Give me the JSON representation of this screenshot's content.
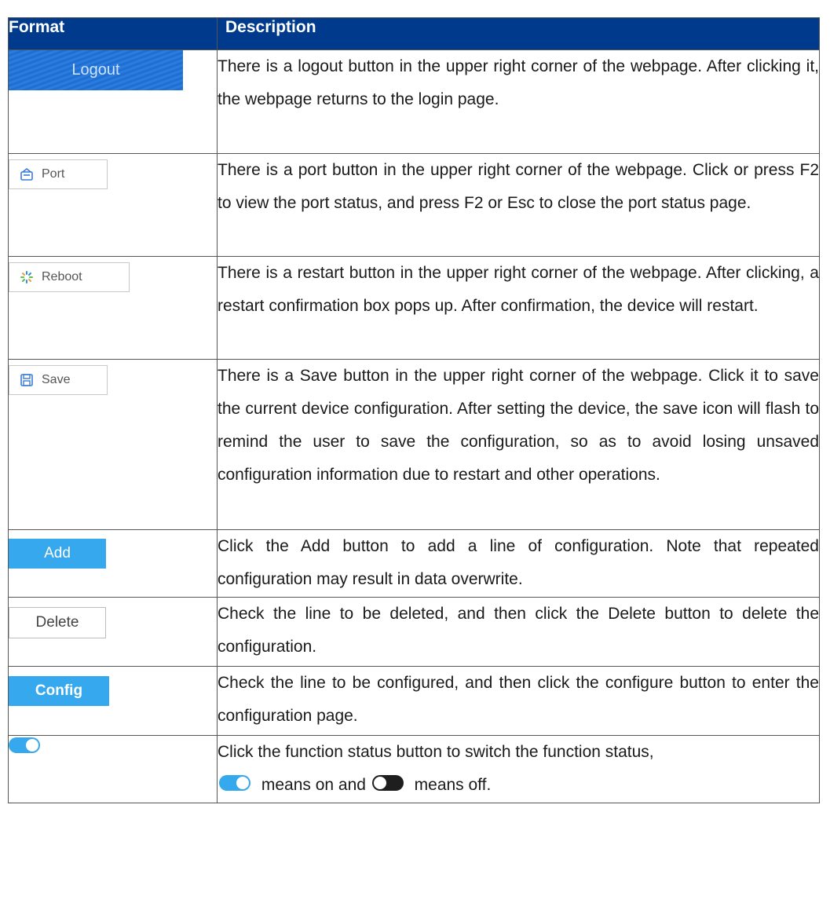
{
  "table": {
    "header_format": "Format",
    "header_description": "Description",
    "rows": [
      {
        "label": "Logout",
        "description": "There is a logout button in the upper right corner of the webpage. After clicking it, the webpage returns to the login page."
      },
      {
        "label": "Port",
        "description": "There is a port button in the upper right corner of the webpage. Click or press F2 to view the port status, and press F2 or Esc to close the port status page."
      },
      {
        "label": "Reboot",
        "description": "There is a restart button in the upper right corner of the webpage. After clicking, a restart confirmation box pops up. After confirmation, the device will restart."
      },
      {
        "label": "Save",
        "description": "There is a Save button in the upper right corner of the webpage. Click it to save the current device configuration. After setting the device, the save icon will flash to remind the user to save the configuration, so as to avoid losing unsaved configuration information due to restart and other operations."
      },
      {
        "label": "Add",
        "description": "Click the Add button to add a line of configuration. Note that repeated configuration may result in data overwrite."
      },
      {
        "label": "Delete",
        "description": "Check the line to be deleted, and then click the Delete button to delete the configuration."
      },
      {
        "label": "Config",
        "description": "Check the line to be configured, and then click the configure button to enter the configuration page."
      },
      {
        "description_prefix": "Click the function status button to switch the function status,",
        "means_on": "means on and",
        "means_off": "means off."
      }
    ]
  },
  "colors": {
    "header_bg": "#003a8c",
    "logout_bg": "#1f6fd0",
    "accent_blue": "#36a8ee",
    "toggle_off": "#1e1e1e"
  },
  "icons": [
    "port-icon",
    "reboot-icon",
    "save-icon",
    "toggle-on-icon",
    "toggle-off-icon"
  ]
}
